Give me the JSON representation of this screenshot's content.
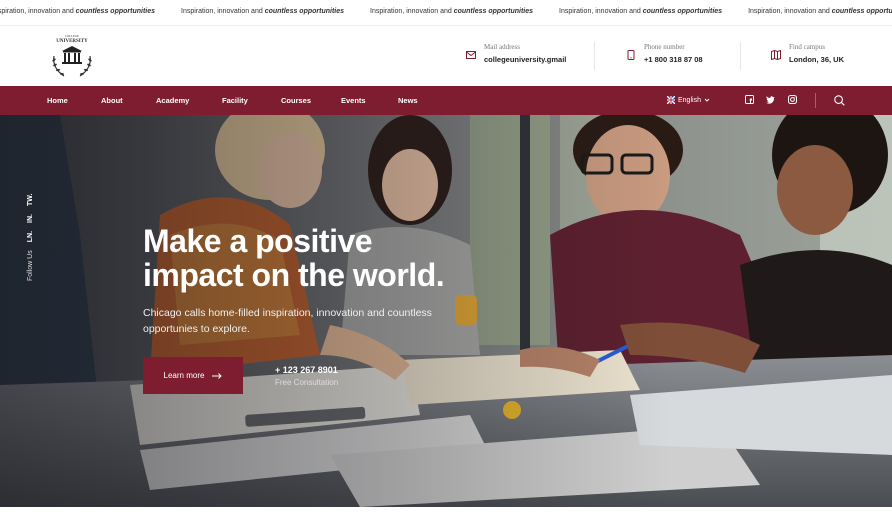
{
  "ticker": {
    "items": [
      {
        "lead": "Inspiration, innovation and ",
        "bold": "countless opportunities"
      },
      {
        "lead": "Inspiration, innovation and ",
        "bold": "countless opportunities"
      },
      {
        "lead": "Inspiration, innovation and ",
        "bold": "countless opportunities"
      },
      {
        "lead": "Inspiration, innovation and ",
        "bold": "countless opportunities"
      },
      {
        "lead": "Inspiration, innovation and ",
        "bold": "countless opportunities"
      },
      {
        "lead": "Inspiration, innovation and ",
        "bold": "countless opportunities"
      }
    ]
  },
  "header": {
    "logo_text": "UNIVERSITY",
    "logo_subtext": "COLLEGE",
    "contacts": [
      {
        "icon": "mail-icon",
        "label": "Mail address",
        "value": "collegeuniversity.gmail"
      },
      {
        "icon": "phone-icon",
        "label": "Phone number",
        "value": "+1 800 318 87 08"
      },
      {
        "icon": "map-icon",
        "label": "Find campus",
        "value": "London, 36, UK"
      }
    ]
  },
  "nav": {
    "items": [
      "Home",
      "About",
      "Academy",
      "Facility",
      "Courses",
      "Events",
      "News"
    ],
    "language": "English",
    "social": [
      "facebook-icon",
      "twitter-icon",
      "instagram-icon"
    ]
  },
  "hero": {
    "follow_label": "Follow Us",
    "follow_links": [
      "LN.",
      "IN.",
      "TW."
    ],
    "title_line1_pre": "Make a ",
    "title_line1_hl": "positive",
    "title_line2": "impact on the world.",
    "subtitle": "Chicago calls home-filled inspiration, innovation and countless opportunies to explore.",
    "cta_label": "Learn more",
    "phone": "+ 123 267 8901",
    "phone_caption": "Free Consultation"
  },
  "colors": {
    "brand": "#7d1d2f"
  }
}
